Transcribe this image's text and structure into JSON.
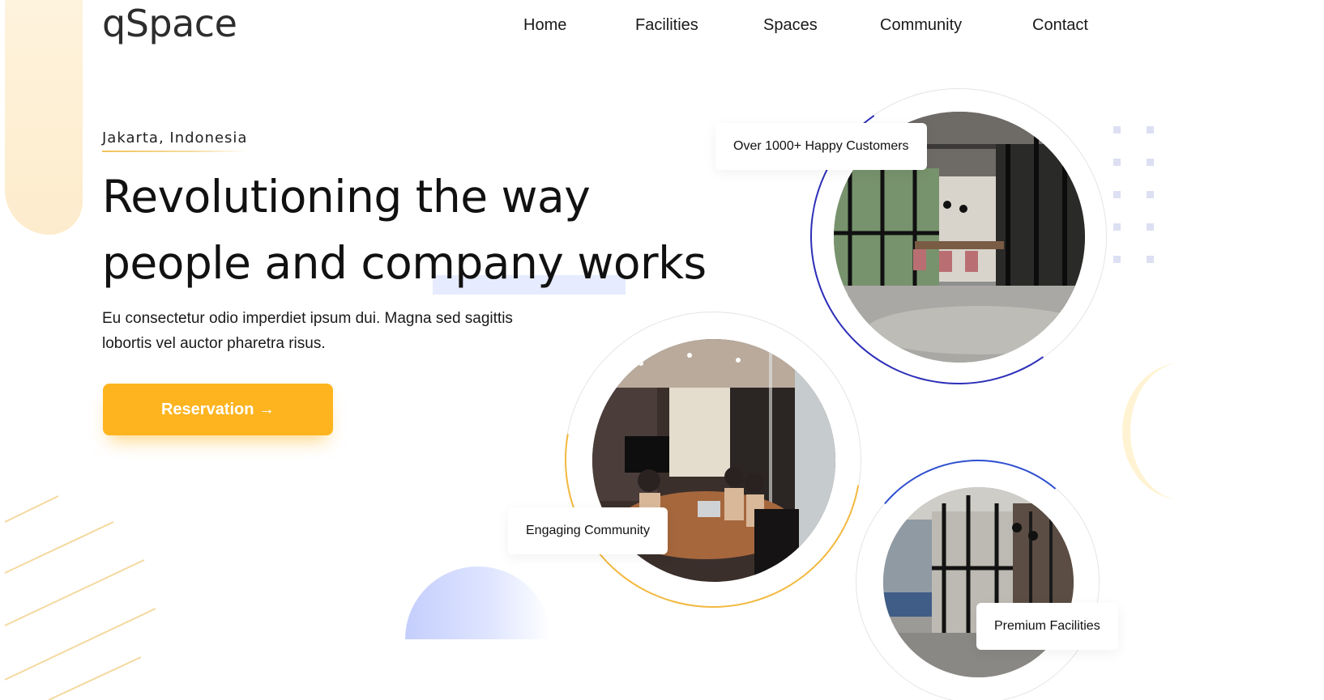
{
  "brand": {
    "logo_text": "qSpace"
  },
  "nav": {
    "items": [
      {
        "label": "Home"
      },
      {
        "label": "Facilities"
      },
      {
        "label": "Spaces"
      },
      {
        "label": "Community"
      },
      {
        "label": "Contact"
      }
    ]
  },
  "hero": {
    "location": "Jakarta, Indonesia",
    "headline_line1": "Revolutioning the way",
    "headline_line2": "people and company works",
    "description": "Eu consectetur odio imperdiet ipsum dui. Magna sed sagittis lobortis vel auctor pharetra risus.",
    "cta_label": "Reservation →"
  },
  "badges": {
    "customers": "Over 1000+ Happy Customers",
    "community": "Engaging Community",
    "facilities": "Premium Facilities"
  },
  "images": {
    "office_image": "office-meeting-room-photo",
    "community_image": "team-meeting-photo",
    "facilities_image": "glass-office-corridor-photo"
  },
  "colors": {
    "accent": "#fdb41f",
    "arc_blue": "#2d2fb8",
    "arc_yellow": "#f3b93f",
    "highlight": "#e6ebff"
  }
}
